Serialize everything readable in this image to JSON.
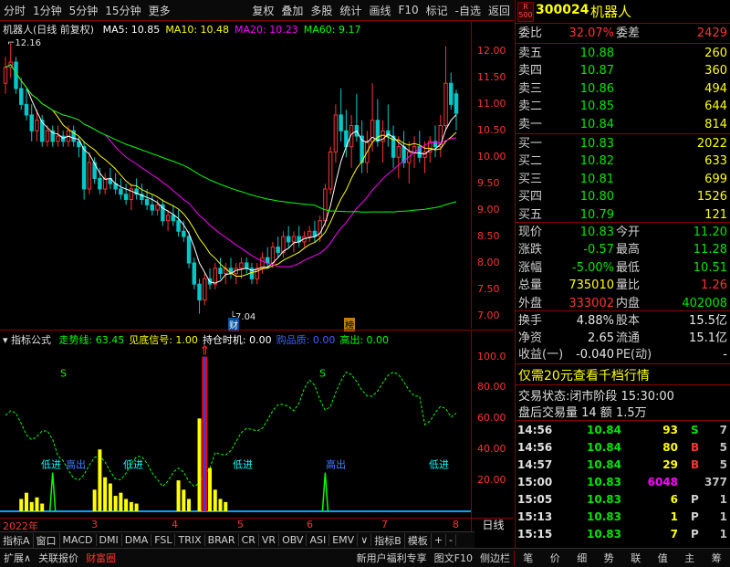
{
  "toolbar": {
    "items": [
      "分时",
      "1分钟",
      "5分钟",
      "15分钟",
      "更多",
      "复权",
      "叠加",
      "多股",
      "统计",
      "画线",
      "F10",
      "标记",
      "-自选",
      "返回"
    ]
  },
  "main": {
    "title": "机器人(日线 前复权)",
    "ma_labels": [
      {
        "text": "MA5: 10.85",
        "color": "#ffffff"
      },
      {
        "text": "MA10: 10.48",
        "color": "#ffff00"
      },
      {
        "text": "MA20: 10.23",
        "color": "#ff00ff"
      },
      {
        "text": "MA60: 9.17",
        "color": "#00ff00"
      }
    ],
    "high_label": "12.16",
    "low_label": "7.04",
    "marker_cai": "财",
    "marker_bang": "榜",
    "price_ticks": [
      "12.00",
      "11.50",
      "11.00",
      "10.50",
      "10.00",
      "9.50",
      "9.00",
      "8.50",
      "8.00",
      "7.50",
      "7.00"
    ],
    "price_min": 6.86,
    "price_max": 12.25
  },
  "indicator": {
    "name": "指标公式",
    "labels": [
      {
        "text": "走势线: 63.45",
        "color": "#00ff00"
      },
      {
        "text": "见底信号: 1.00",
        "color": "#ffff00"
      },
      {
        "text": "持仓时机: 0.00",
        "color": "#ffffff"
      },
      {
        "text": "购品质: 0.00",
        "color": "#4060ff"
      },
      {
        "text": "高出: 0.00",
        "color": "#00ff00"
      }
    ],
    "ticks": [
      "100.0",
      "80.00",
      "60.00",
      "40.00",
      "20.00"
    ],
    "signals": [
      {
        "text": "低进",
        "x": 45,
        "color": "#00ffff"
      },
      {
        "text": "高出",
        "x": 72,
        "color": "#4080ff"
      },
      {
        "text": "低进",
        "x": 135,
        "color": "#00ffff"
      },
      {
        "text": "低进",
        "x": 255,
        "color": "#00ffff"
      },
      {
        "text": "高出",
        "x": 357,
        "color": "#4080ff"
      },
      {
        "text": "低进",
        "x": 470,
        "color": "#00ffff"
      }
    ],
    "s_marks": [
      {
        "text": "S",
        "x": 66
      },
      {
        "text": "S",
        "x": 350
      }
    ]
  },
  "xaxis": {
    "labels": [
      {
        "text": "2022年",
        "x": 3
      },
      {
        "text": "3",
        "x": 100
      },
      {
        "text": "4",
        "x": 188
      },
      {
        "text": "5",
        "x": 260
      },
      {
        "text": "6",
        "x": 336
      },
      {
        "text": "7",
        "x": 418
      },
      {
        "text": "8",
        "x": 496
      }
    ],
    "period": "日线"
  },
  "quote": {
    "code": "300024",
    "name": "机器人",
    "r_badge": "R",
    "badge_num": "500",
    "weibi_label": "委比",
    "weibi": "32.07%",
    "weicha_label": "委差",
    "weicha": "2429",
    "asks": [
      {
        "label": "卖五",
        "price": "10.88",
        "vol": "260"
      },
      {
        "label": "卖四",
        "price": "10.87",
        "vol": "360"
      },
      {
        "label": "卖三",
        "price": "10.86",
        "vol": "494"
      },
      {
        "label": "卖二",
        "price": "10.85",
        "vol": "644"
      },
      {
        "label": "卖一",
        "price": "10.84",
        "vol": "814"
      }
    ],
    "bids": [
      {
        "label": "买一",
        "price": "10.83",
        "vol": "2022"
      },
      {
        "label": "买二",
        "price": "10.82",
        "vol": "633"
      },
      {
        "label": "买三",
        "price": "10.81",
        "vol": "699"
      },
      {
        "label": "买四",
        "price": "10.80",
        "vol": "1526"
      },
      {
        "label": "买五",
        "price": "10.79",
        "vol": "121"
      }
    ],
    "stats": [
      {
        "l1": "现价",
        "v1": "10.83",
        "c1": "#00e600",
        "l2": "今开",
        "v2": "11.20",
        "c2": "#00e600"
      },
      {
        "l1": "涨跌",
        "v1": "-0.57",
        "c1": "#00e600",
        "l2": "最高",
        "v2": "11.28",
        "c2": "#00e600"
      },
      {
        "l1": "涨幅",
        "v1": "-5.00%",
        "c1": "#00e600",
        "l2": "最低",
        "v2": "10.51",
        "c2": "#00e600"
      },
      {
        "l1": "总量",
        "v1": "735010",
        "c1": "#ffff00",
        "l2": "量比",
        "v2": "1.26",
        "c2": "#ff3232"
      },
      {
        "l1": "外盘",
        "v1": "333002",
        "c1": "#ff3232",
        "l2": "内盘",
        "v2": "402008",
        "c2": "#00e600"
      }
    ],
    "stats2": [
      {
        "l1": "换手",
        "v1": "4.88%",
        "l2": "股本",
        "v2": "15.5亿"
      },
      {
        "l1": "净资",
        "v1": "2.65",
        "l2": "流通",
        "v2": "15.1亿"
      },
      {
        "l1": "收益(一)",
        "v1": "-0.040",
        "l2": "PE(动)",
        "v2": "-"
      }
    ],
    "promo": "仅需20元查看千档行情",
    "status_label": "交易状态:",
    "status": "闭市阶段 15:30:00",
    "after_hours": "盘后交易量 14 额 1.5万",
    "ticks": [
      {
        "time": "14:56",
        "price": "10.84",
        "vol": "93",
        "flag": "S",
        "n": "7",
        "vc": "#ffff00",
        "fc": "#00e600"
      },
      {
        "time": "14:56",
        "price": "10.84",
        "vol": "80",
        "flag": "B",
        "n": "5",
        "vc": "#ffff00",
        "fc": "#ff3232"
      },
      {
        "time": "14:57",
        "price": "10.84",
        "vol": "29",
        "flag": "B",
        "n": "5",
        "vc": "#ffff00",
        "fc": "#ff3232"
      },
      {
        "time": "15:00",
        "price": "10.83",
        "vol": "6048",
        "flag": "",
        "n": "377",
        "vc": "#ff00ff",
        "fc": "#d0d0d0"
      },
      {
        "time": "15:05",
        "price": "10.83",
        "vol": "6",
        "flag": "P",
        "n": "1",
        "vc": "#ffff00",
        "fc": "#d0d0d0"
      },
      {
        "time": "15:13",
        "price": "10.83",
        "vol": "1",
        "flag": "P",
        "n": "1",
        "vc": "#ffff00",
        "fc": "#d0d0d0"
      },
      {
        "time": "15:15",
        "price": "10.83",
        "vol": "7",
        "flag": "P",
        "n": "1",
        "vc": "#ffff00",
        "fc": "#d0d0d0"
      }
    ]
  },
  "bottom_tabs": [
    "指标A",
    "窗口",
    "MACD",
    "DMI",
    "DMA",
    "FSL",
    "TRIX",
    "BRAR",
    "CR",
    "VR",
    "OBV",
    "ASI",
    "EMV",
    "∨",
    "指标B",
    "模板",
    "+",
    "-"
  ],
  "bottom_bar": {
    "left": [
      "扩展∧",
      "关联报价",
      "财富圈"
    ],
    "right": [
      "新用户福利专享",
      "图文F10",
      "侧边栏"
    ],
    "quote_tabs": [
      "笔",
      "价",
      "细",
      "势",
      "联",
      "值",
      "主",
      "筹"
    ]
  },
  "chart_data": {
    "type": "candlestick",
    "y_range": [
      6.86,
      12.25
    ],
    "candles": [
      [
        11.4,
        11.9,
        11.2,
        11.7
      ],
      [
        11.7,
        12.16,
        11.5,
        11.8
      ],
      [
        11.8,
        11.9,
        11.2,
        11.3
      ],
      [
        11.3,
        11.5,
        10.9,
        11.0
      ],
      [
        11.0,
        11.3,
        10.7,
        10.8
      ],
      [
        10.8,
        11.0,
        10.3,
        10.5
      ],
      [
        10.5,
        10.9,
        10.3,
        10.7
      ],
      [
        10.7,
        10.8,
        10.2,
        10.3
      ],
      [
        10.3,
        10.6,
        10.2,
        10.5
      ],
      [
        10.5,
        10.6,
        10.2,
        10.3
      ],
      [
        10.3,
        10.6,
        10.2,
        10.4
      ],
      [
        10.4,
        10.5,
        10.2,
        10.3
      ],
      [
        10.3,
        10.6,
        10.2,
        10.5
      ],
      [
        10.5,
        10.6,
        10.2,
        10.3
      ],
      [
        10.3,
        10.4,
        10.0,
        10.2
      ],
      [
        10.2,
        10.3,
        9.2,
        9.4
      ],
      [
        9.4,
        10.1,
        9.3,
        9.9
      ],
      [
        9.9,
        10.0,
        9.5,
        9.6
      ],
      [
        9.6,
        9.8,
        9.3,
        9.4
      ],
      [
        9.4,
        9.7,
        9.3,
        9.6
      ],
      [
        9.6,
        9.8,
        9.4,
        9.5
      ],
      [
        9.5,
        9.7,
        9.3,
        9.4
      ],
      [
        9.4,
        9.6,
        9.2,
        9.3
      ],
      [
        9.3,
        9.5,
        9.1,
        9.2
      ],
      [
        9.2,
        9.5,
        9.0,
        9.4
      ],
      [
        9.4,
        9.6,
        9.2,
        9.3
      ],
      [
        9.3,
        9.5,
        9.1,
        9.2
      ],
      [
        9.2,
        9.4,
        9.0,
        9.1
      ],
      [
        9.1,
        9.3,
        8.9,
        9.0
      ],
      [
        9.0,
        9.2,
        8.9,
        9.1
      ],
      [
        9.1,
        9.2,
        8.7,
        8.8
      ],
      [
        8.8,
        9.0,
        8.6,
        8.9
      ],
      [
        8.9,
        9.1,
        8.7,
        8.8
      ],
      [
        8.8,
        9.0,
        8.5,
        8.6
      ],
      [
        8.6,
        8.8,
        8.4,
        8.5
      ],
      [
        8.5,
        8.6,
        7.9,
        8.0
      ],
      [
        8.0,
        8.1,
        7.5,
        7.6
      ],
      [
        7.6,
        7.7,
        7.04,
        7.3
      ],
      [
        7.3,
        7.8,
        7.2,
        7.7
      ],
      [
        7.7,
        7.9,
        7.5,
        7.6
      ],
      [
        7.6,
        8.0,
        7.5,
        7.9
      ],
      [
        7.9,
        8.1,
        7.7,
        7.8
      ],
      [
        7.8,
        8.0,
        7.6,
        7.9
      ],
      [
        7.9,
        8.1,
        7.7,
        7.8
      ],
      [
        7.8,
        8.0,
        7.6,
        7.9
      ],
      [
        7.9,
        8.1,
        7.7,
        8.0
      ],
      [
        8.0,
        8.1,
        7.8,
        7.9
      ],
      [
        7.9,
        8.0,
        7.6,
        7.7
      ],
      [
        7.7,
        8.0,
        7.6,
        7.9
      ],
      [
        7.9,
        8.2,
        7.8,
        8.1
      ],
      [
        8.1,
        8.3,
        7.9,
        8.0
      ],
      [
        8.0,
        8.4,
        7.9,
        8.3
      ],
      [
        8.3,
        8.5,
        8.1,
        8.2
      ],
      [
        8.2,
        8.6,
        8.1,
        8.5
      ],
      [
        8.5,
        8.7,
        8.3,
        8.4
      ],
      [
        8.4,
        8.6,
        8.2,
        8.5
      ],
      [
        8.5,
        8.7,
        8.3,
        8.4
      ],
      [
        8.4,
        8.6,
        8.3,
        8.5
      ],
      [
        8.5,
        8.7,
        8.4,
        8.6
      ],
      [
        8.6,
        8.8,
        8.4,
        8.5
      ],
      [
        8.5,
        8.9,
        8.4,
        8.8
      ],
      [
        8.8,
        9.5,
        8.7,
        9.4
      ],
      [
        9.4,
        10.2,
        9.3,
        10.1
      ],
      [
        10.1,
        11.0,
        9.9,
        10.8
      ],
      [
        10.8,
        11.3,
        10.3,
        10.5
      ],
      [
        10.5,
        10.9,
        10.0,
        10.2
      ],
      [
        10.2,
        10.8,
        9.8,
        10.6
      ],
      [
        10.6,
        11.2,
        10.3,
        10.4
      ],
      [
        10.4,
        10.7,
        9.7,
        9.9
      ],
      [
        9.9,
        10.5,
        9.7,
        10.3
      ],
      [
        10.3,
        11.4,
        10.1,
        10.7
      ],
      [
        10.7,
        11.1,
        10.2,
        10.3
      ],
      [
        10.3,
        10.7,
        9.9,
        10.5
      ],
      [
        10.5,
        11.0,
        10.2,
        10.4
      ],
      [
        10.4,
        10.6,
        9.8,
        10.0
      ],
      [
        10.0,
        10.4,
        9.6,
        10.2
      ],
      [
        10.2,
        10.5,
        9.8,
        9.9
      ],
      [
        9.9,
        10.3,
        9.5,
        10.1
      ],
      [
        10.1,
        10.4,
        9.8,
        10.2
      ],
      [
        10.2,
        10.5,
        9.9,
        10.0
      ],
      [
        10.0,
        10.3,
        9.7,
        10.1
      ],
      [
        10.1,
        10.4,
        9.9,
        10.3
      ],
      [
        10.3,
        10.6,
        10.0,
        10.2
      ],
      [
        10.2,
        10.8,
        10.0,
        10.6
      ],
      [
        10.6,
        12.1,
        10.5,
        11.4
      ],
      [
        11.4,
        11.6,
        10.9,
        11.0
      ],
      [
        11.2,
        11.28,
        10.51,
        10.83
      ]
    ]
  }
}
